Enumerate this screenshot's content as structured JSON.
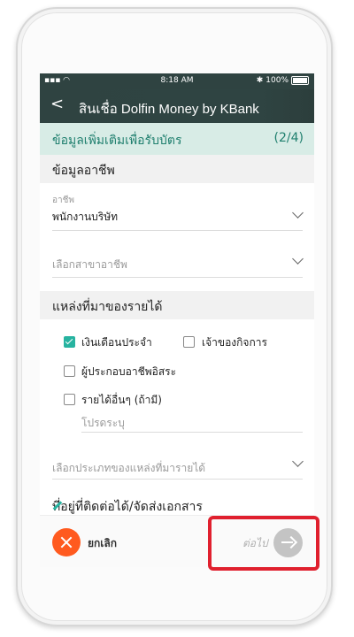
{
  "status_bar": {
    "signal": "▪▪▪ ◠",
    "time": "8:18 AM",
    "bluetooth": "✱",
    "battery": "100%"
  },
  "header": {
    "back_icon": "back-arrow-icon",
    "title": "สินเชื่อ Dolfin Money by KBank"
  },
  "step": {
    "label": "ข้อมูลเพิ่มเติมเพื่อรับบัตร",
    "count": "(2/4)"
  },
  "occupation_section": {
    "heading": "ข้อมูลอาชีพ",
    "occupation": {
      "label": "อาชีพ",
      "value": "พนักงานบริษัท"
    },
    "occupation_branch": {
      "placeholder": "เลือกสาขาอาชีพ"
    }
  },
  "income_section": {
    "heading": "แหล่งที่มาของรายได้",
    "options": [
      {
        "label": "เงินเดือนประจำ",
        "checked": true
      },
      {
        "label": "เจ้าของกิจการ",
        "checked": false
      },
      {
        "label": "ผู้ประกอบอาชีพอิสระ",
        "checked": false
      },
      {
        "label": "รายได้อื่นๆ (ถ้ามี)",
        "checked": false
      }
    ],
    "other_placeholder": "โปรดระบุ",
    "source_type_placeholder": "เลือกประเภทของแหล่งที่มารายได้"
  },
  "address_section": {
    "heading": "ที่อยู่ที่ติดต่อได้/จัดส่งเอกสาร",
    "edit_icon": "pencil-icon"
  },
  "footer": {
    "cancel_label": "ยกเลิก",
    "next_label": "ต่อไป"
  },
  "colors": {
    "header": "#2f4341",
    "accent": "#27b3a0",
    "cancel": "#ff5a1f",
    "highlight": "#e0202e"
  }
}
